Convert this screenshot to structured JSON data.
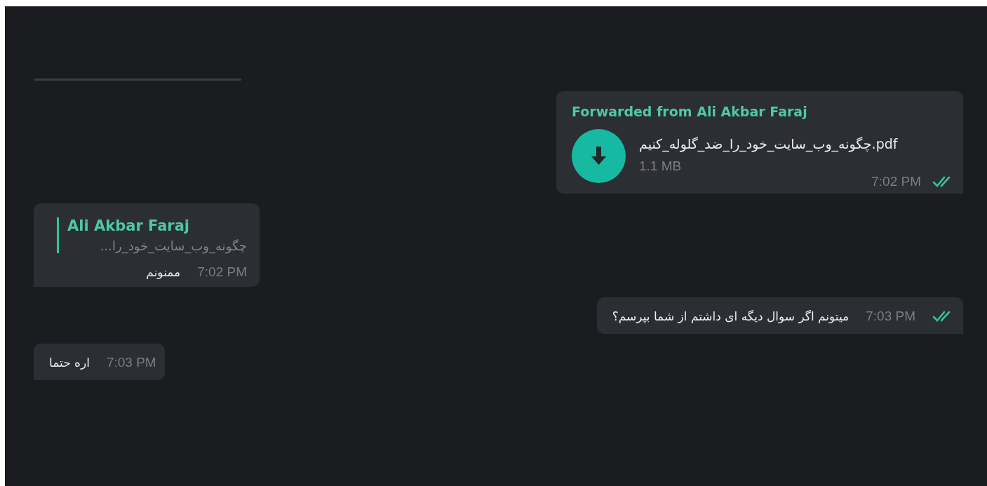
{
  "messages": [
    {
      "kind": "file",
      "outgoing": true,
      "forwarded_from": "Forwarded from Ali Akbar Faraj",
      "file_name": "چگونه_وب_سایت_خود_را_ضد_گلوله_کنیم.pdf",
      "size": "1.1 MB",
      "time": "7:02 PM",
      "read": true
    },
    {
      "kind": "reply",
      "outgoing": false,
      "reply_author": "Ali Akbar Faraj",
      "reply_text": "چگونه_وب_سایت_خود_را...",
      "text": "ممنونم",
      "time": "7:02 PM"
    },
    {
      "kind": "text",
      "outgoing": true,
      "text": "میتونم اگر سوال دیگه ای داشتم از شما بپرسم؟",
      "time": "7:03 PM",
      "read": true
    },
    {
      "kind": "text",
      "outgoing": false,
      "text": "اره حتما",
      "time": "7:03 PM"
    }
  ]
}
